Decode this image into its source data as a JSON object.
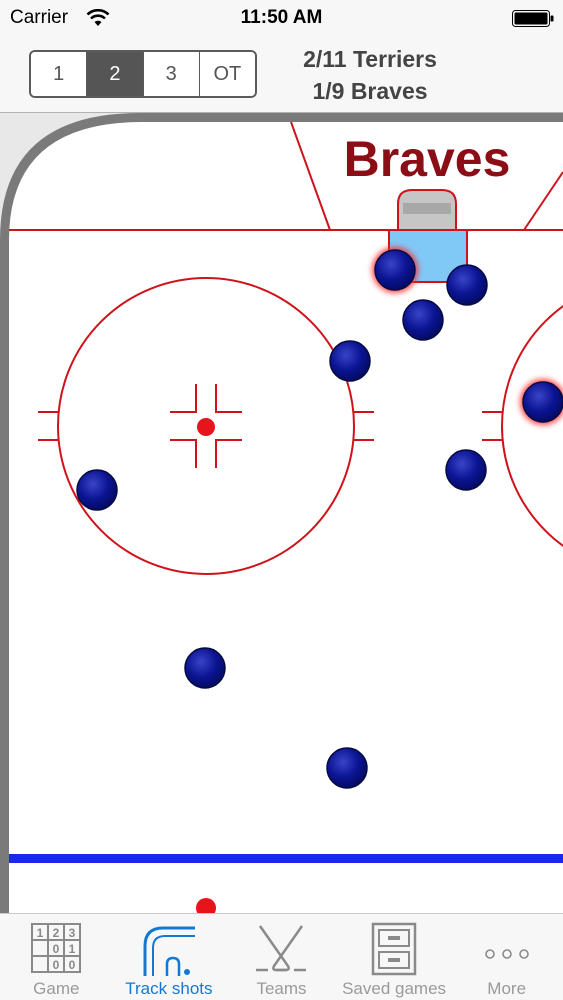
{
  "status_bar": {
    "carrier": "Carrier",
    "time": "11:50 AM"
  },
  "periods": {
    "items": [
      "1",
      "2",
      "3",
      "OT"
    ],
    "selected": "2"
  },
  "score": {
    "line1": "2/11 Terriers",
    "line2": "1/9 Braves"
  },
  "rink": {
    "team_label": "Braves",
    "team_label_color": "#8b0d15",
    "line_color": "#d0121b",
    "blue_line_color": "#1a29e8",
    "crease_color": "#80c8f6",
    "shot_color": "#0b1492"
  },
  "tabs": [
    {
      "label": "Game",
      "icon": "scoreboard-grid-icon"
    },
    {
      "label": "Track shots",
      "icon": "rink-shot-icon"
    },
    {
      "label": "Teams",
      "icon": "crossed-sticks-icon"
    },
    {
      "label": "Saved games",
      "icon": "file-cabinet-icon"
    },
    {
      "label": "More",
      "icon": "more-dots-icon"
    }
  ],
  "active_tab": "Track shots"
}
